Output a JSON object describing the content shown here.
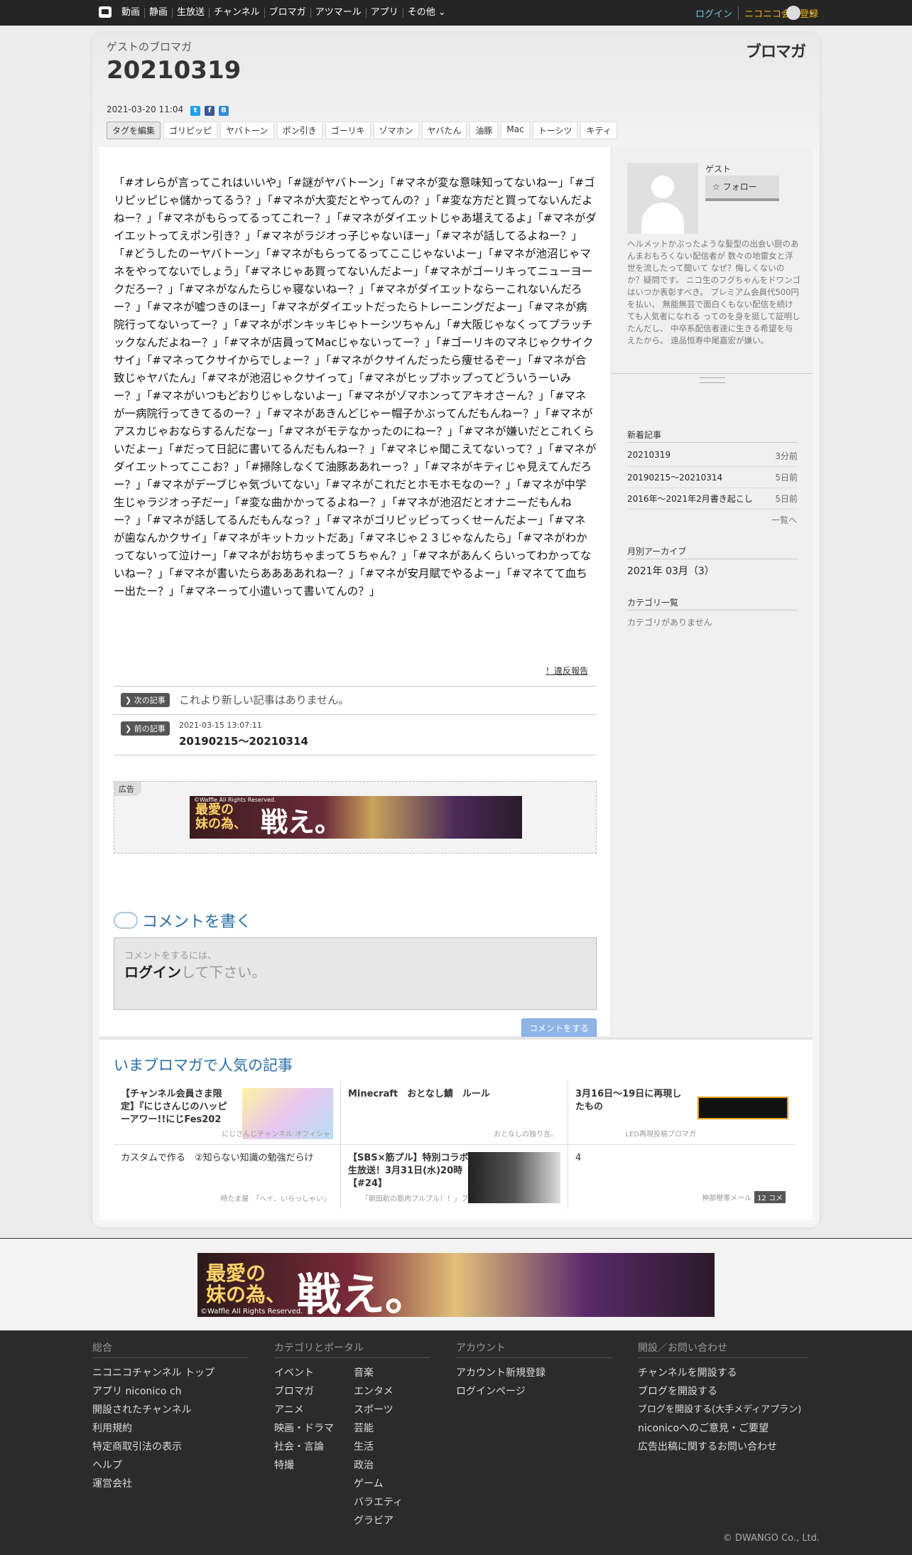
{
  "topnav": {
    "items": [
      "動画",
      "静画",
      "生放送",
      "チャンネル",
      "ブロマガ",
      "アツマール",
      "アプリ",
      "その他"
    ],
    "login": "ログイン",
    "register": "ニコニコ会員登録"
  },
  "header": {
    "blog_name": "ゲストのブロマガ",
    "title": "20210319",
    "brand": "ブロマガ",
    "date": "2021-03-20 11:04",
    "tags": [
      "タグを編集",
      "ゴリピッピ",
      "ヤバトーン",
      "ポン引き",
      "ゴーリキ",
      "ゾマホン",
      "ヤバたん",
      "油豚",
      "Mac",
      "トーシツ",
      "キティ"
    ]
  },
  "article": {
    "body": "「#オレらが言ってこれはいいや」「#謎がヤバトーン」「#マネが変な意味知ってないねー」「#ゴリピッピじゃ儲かってるう？」「#マネが大変だとやってんの？」「#変な方だと買ってないんだよねー？」「#マネがもらってるってこれー？」「#マネがダイエットじゃあ堪えてるよ」「#マネがダイエットってえポン引き？」「#マネがラジオっ子じゃないほー」「#マネが話してるよねー？」「#どうしたのーヤバトーン」「#マネがもらってるってここじゃないよー」「#マネが池沼じゃマネをやってないでしょう」「#マネじゃあ買ってないんだよー」「#マネがゴーリキってニューヨークだろー？」「#マネがなんたらじゃ寝ないねー？」「#マネがダイエットならーこれないんだろー？」「#マネが嘘つきのほー」「#マネがダイエットだったらトレーニングだよー」「#マネが病院行ってないってー？」「#マネがポンキッキじゃトーシツちゃん」「#大阪じゃなくってプラッチックなんだよねー？」「#マネが店員ってMacじゃないってー？」「#ゴーリキのマネじゃクサイクサイ」「#マネってクサイからでしょー？」「#マネがクサイんだったら痩せるぞー」「#マネが合致じゃヤバたん」「#マネが池沼じゃクサイって」「#マネがヒップホップってどういうーいみー？」「#マネがいつもどおりじゃしないよー」「#マネがゾマホンってアキオさーん？」「#マネが一病院行ってきてるのー？」「#マネがあきんどじゃー帽子かぶってんだもんねー？」「#マネがアスカじゃおならするんだなー」「#マネがモテなかったのにねー？」「#マネが嫌いだとこれくらいだよー」「#だって日記に書いてるんだもんねー？」「#マネじゃ聞こえてないって？」「#マネがダイエットってここお？」「#掃除しなくて油豚ああれーっ？」「#マネがキティじゃ見えてんだろー？」「#マネがデーブじゃ気づいてない」「#マネがこれだとホモホモなのー？」「#マネが中学生じゃラジオっ子だー」「#変な曲かかってるよねー？」「#マネが池沼だとオナニーだもんねー？」「#マネが話してるんだもんなっ？」「#マネがゴリピッピってっくせーんだよー」「#マネが歯なんかクサイ」「#マネがキットカットだあ」「#マネじゃ２３じゃなんたら」「#マネがわかってないって泣けー」「#マネがお坊ちゃまって５ちゃん？」「#マネがあんくらいってわかってないねー？」「#マネが書いたらああああれねー？」「#マネが安月賦でやるよー」「#マネてて血ちー出たー？」「#マネーって小遣いって書いてんの？」",
    "report": "！違反報告"
  },
  "pager": {
    "next_label": "次の記事",
    "next_text": "これより新しい記事はありません。",
    "prev_label": "前の記事",
    "prev_date": "2021-03-15 13:07:11",
    "prev_title": "20190215～20210314"
  },
  "ad": {
    "label": "広告",
    "copy": "©Waffle All Rights Reserved.",
    "catch": "最愛の妹の為、戦え。",
    "catch_small": "最愛の\n妹の為、",
    "catch_big": "戦え。"
  },
  "comment": {
    "heading": "コメントを書く",
    "hint": "コメントをするには、",
    "login": "ログイン",
    "login_suffix": "して下さい。",
    "submit": "コメントをする"
  },
  "sidebar": {
    "profile_name": "ゲスト",
    "follow": "フォロー",
    "description": "ヘルメットかぶったような髪型の出会い厨のあんまおもろくない配信者が 数々の地雷女と浮世を流したって聞いて なぜ？悔しくないのか？疑問です。 ニコ生のフグちゃんをドワンゴはいつか表彰すべき。 プレミアム会員代500円を払い、 無能無芸で面白くもない配信を続けても人気者になれる ってのを身を挺して証明したんだし、 中卒系配信者達に生きる希望を与えたから。 遠品恒寿中尾嘉宏が嫌い。",
    "recent_title": "新着記事",
    "recent": [
      {
        "title": "20210319",
        "ago": "3分前"
      },
      {
        "title": "20190215～20210314",
        "ago": "5日前"
      },
      {
        "title": "2016年～2021年2月書き起こし",
        "ago": "5日前"
      }
    ],
    "recent_more": "一覧へ",
    "archive_title": "月別アーカイブ",
    "archive_item": "2021年 03月（3）",
    "category_title": "カテゴリ一覧",
    "category_none": "カテゴリがありません"
  },
  "popular": {
    "title": "いまブロマガで人気の記事",
    "items": [
      {
        "title": "【チャンネル会員さま限定】『にじさんじのハッピーアワー!!にじFes202",
        "source": "にじさんじチャンネル オフィシャ"
      },
      {
        "title": "Minecraft　おとなし鯖　ルール",
        "source": "おとなしの独り言。"
      },
      {
        "title": "3月16日～19日に再現したもの",
        "source": "LED再現投稿ブロマガ"
      },
      {
        "title": "カスタムで作る　②知らない知識の勉強だらけ",
        "source": "時たま屋　「へイ、いらっしゃい」"
      },
      {
        "title": "【SBS×筋プル】特別コラボ生放送！3月31日(水)20時【#24】",
        "source": "「朝田航の筋肉プルプル！！」ブ"
      },
      {
        "title": "4",
        "source": "神部橙軍メール",
        "badge": "12 コメ"
      }
    ]
  },
  "footer": {
    "col1_head": "総合",
    "col1": [
      "ニコニコチャンネル トップ",
      "アプリ niconico ch",
      "開設されたチャンネル",
      "利用規約",
      "特定商取引法の表示",
      "ヘルプ",
      "運営会社"
    ],
    "col2_head": "カテゴリとポータル",
    "col2a": [
      "イベント",
      "ブロマガ",
      "アニメ",
      "映画・ドラマ",
      "社会・言論",
      "特撮"
    ],
    "col2b": [
      "音楽",
      "エンタメ",
      "スポーツ",
      "芸能",
      "生活",
      "政治",
      "ゲーム",
      "バラエティ",
      "グラビア"
    ],
    "col3_head": "アカウント",
    "col3": [
      "アカウント新規登録",
      "ログインページ"
    ],
    "col4_head": "開設／お問い合わせ",
    "col4": [
      "チャンネルを開設する",
      "ブログを開設する",
      "ブログを開設する(大手メディアプラン)",
      "niconicoへのご意見・ご要望",
      "広告出稿に関するお問い合わせ"
    ],
    "copyright": "© DWANGO Co., Ltd."
  }
}
